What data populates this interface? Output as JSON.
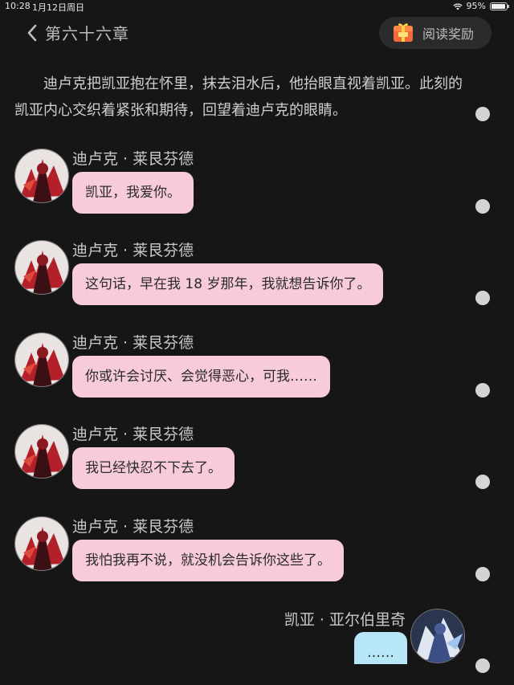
{
  "status": {
    "time": "10:28",
    "date": "1月12日周日",
    "battery": "95%",
    "battery_level": 0.95
  },
  "nav": {
    "chapter_title": "第六十六章",
    "reward_label": "阅读奖励"
  },
  "narration": "迪卢克把凯亚抱在怀里，抹去泪水后，他抬眼直视着凯亚。此刻的凯亚内心交织着紧张和期待，回望着迪卢克的眼睛。",
  "messages": [
    {
      "speaker": "迪卢克 · 莱艮芬德",
      "text": "凯亚，我爱你。"
    },
    {
      "speaker": "迪卢克 · 莱艮芬德",
      "text": "这句话，早在我 18 岁那年，我就想告诉你了。"
    },
    {
      "speaker": "迪卢克 · 莱艮芬德",
      "text": "你或许会讨厌、会觉得恶心，可我……"
    },
    {
      "speaker": "迪卢克 · 莱艮芬德",
      "text": "我已经快忍不下去了。"
    },
    {
      "speaker": "迪卢克 · 莱艮芬德",
      "text": "我怕我再不说，就没机会告诉你这些了。"
    },
    {
      "speaker": "凯亚 · 亚尔伯里奇",
      "text": "……"
    }
  ],
  "colors": {
    "background": "#161616",
    "left_bubble": "#f7ccd8",
    "right_bubble": "#b7e6f7"
  }
}
